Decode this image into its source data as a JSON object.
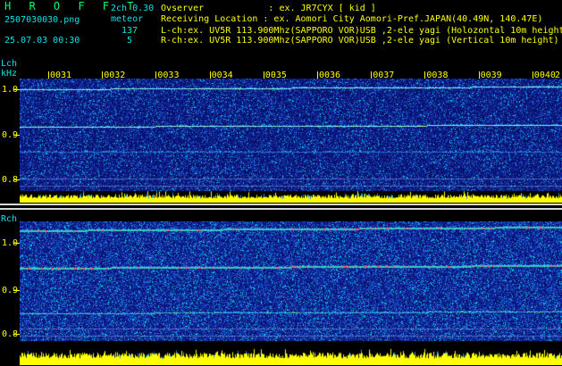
{
  "header": {
    "brand": "H R O F F T",
    "file": "2507030030.png",
    "datetime": "25.07.03 00:30",
    "channel": "2ch 0.30",
    "mode": "meteor",
    "count_l": "137",
    "count_r": "5",
    "lines": [
      "Ovserver            : ex. JR7CYX [ kid ]",
      "Receiving Location : ex. Aomori City Aomori-Pref.JAPAN(40.49N, 140.47E)",
      "L-ch:ex. UV5R 113.900Mhz(SAPPORO VOR)USB ,2-ele yagi (Holozontal 10m height)",
      "R-ch:ex. UV5R 113.900Mhz(SAPPORO VOR)USB ,2-ele yagi (Vertical 10m height)"
    ]
  },
  "minutes": [
    "0031",
    "0032",
    "0033",
    "0034",
    "0035",
    "0036",
    "0037",
    "0038",
    "0039",
    "0040"
  ],
  "edge_marker": "2",
  "lch": {
    "label": "Lch",
    "unit": "kHz",
    "ticks": [
      "1.0",
      "0.9",
      "0.8"
    ]
  },
  "rch": {
    "label": "Rch",
    "ticks": [
      "1.0",
      "0.9",
      "0.8"
    ]
  },
  "colors": {
    "text": "#ffff00",
    "info": "#00e6e6",
    "background": "#000000"
  }
}
